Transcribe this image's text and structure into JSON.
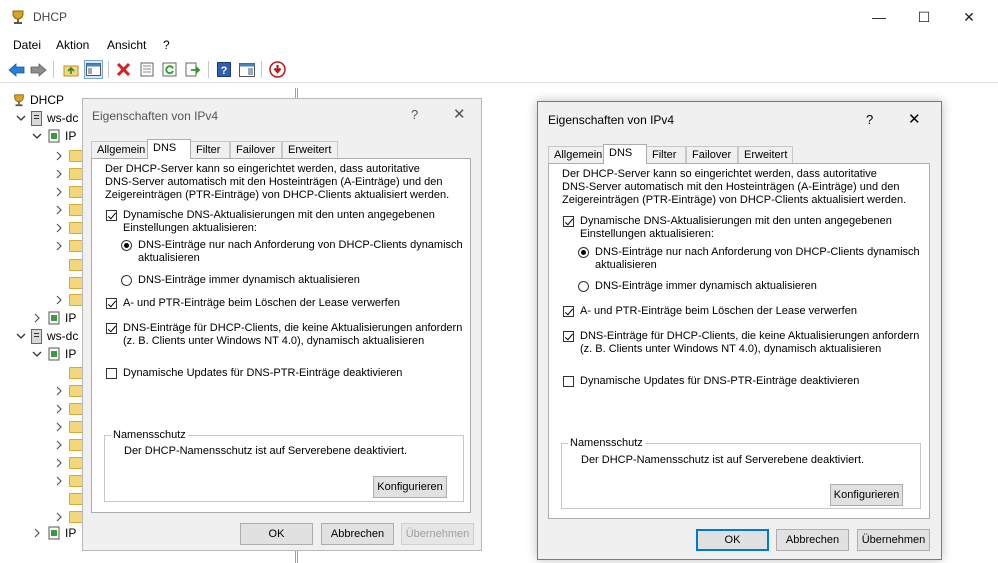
{
  "window": {
    "title": "DHCP",
    "controls": {
      "minimize": "—",
      "maximize": "☐",
      "close": "✕"
    }
  },
  "menu": [
    "Datei",
    "Aktion",
    "Ansicht",
    "?"
  ],
  "toolbar_icons": [
    "back-arrow-icon",
    "forward-arrow-icon",
    "folder-up-icon",
    "console-tree-icon",
    "delete-icon",
    "properties-icon",
    "refresh-icon",
    "export-list-icon",
    "help-icon",
    "show-hide-icon",
    "stop-icon"
  ],
  "tree": {
    "root": "DHCP",
    "items": [
      {
        "label": "ws-dc",
        "type": "server"
      },
      {
        "label": "IP",
        "type": "ip"
      },
      {
        "label": "IP",
        "type": "ip"
      },
      {
        "label": "ws-dc",
        "type": "server"
      },
      {
        "label": "IP",
        "type": "ip"
      },
      {
        "label": "IP",
        "type": "ip"
      }
    ]
  },
  "dialog": {
    "title": "Eigenschaften von IPv4",
    "help": "?",
    "close": "✕",
    "tabs": [
      "Allgemein",
      "DNS",
      "Filter",
      "Failover",
      "Erweitert"
    ],
    "active_tab": "DNS",
    "intro": [
      "Der DHCP-Server kann so eingerichtet werden, dass autoritative",
      "DNS-Server automatisch mit den Hosteinträgen (A-Einträge) und den",
      "Zeigereinträgen (PTR-Einträge) von DHCP-Clients aktualisiert werden."
    ],
    "dyn_updates": {
      "checked": true,
      "lines": [
        "Dynamische DNS-Aktualisierungen mit den unten angegebenen",
        "Einstellungen aktualisieren:"
      ]
    },
    "radio_on_request": {
      "selected": true,
      "lines": [
        "DNS-Einträge nur nach Anforderung von DHCP-Clients dynamisch",
        "aktualisieren"
      ]
    },
    "radio_always": {
      "selected": false,
      "label": "DNS-Einträge immer dynamisch aktualisieren"
    },
    "discard_on_delete": {
      "checked": true,
      "label": "A- und PTR-Einträge beim Löschen der Lease verwerfen"
    },
    "legacy_clients": {
      "checked": true,
      "lines": [
        "DNS-Einträge für DHCP-Clients, die keine Aktualisierungen anfordern",
        "(z. B. Clients unter Windows NT 4.0), dynamisch aktualisieren"
      ]
    },
    "disable_ptr": {
      "checked": false,
      "label": "Dynamische Updates für DNS-PTR-Einträge deaktivieren"
    },
    "name_protection": {
      "label": "Namensschutz",
      "text": "Der DHCP-Namensschutz ist auf Serverebene deaktiviert.",
      "button": "Konfigurieren"
    },
    "buttons": {
      "ok": "OK",
      "cancel": "Abbrechen",
      "apply": "Übernehmen"
    },
    "apply_enabled_left": false,
    "apply_enabled_right": true
  },
  "colors": {
    "accent": "#0078d7",
    "dialog_bg": "#f0f0f0",
    "folder": "#f3d77a"
  }
}
